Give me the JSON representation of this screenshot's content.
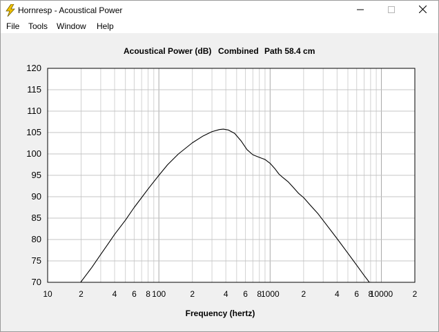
{
  "window": {
    "title": "Hornresp - Acoustical Power",
    "icon": "lightning-bolt-icon"
  },
  "titlebar_buttons": [
    "minimize-icon",
    "maximize-icon",
    "close-icon"
  ],
  "menu": {
    "file": "File",
    "tools": "Tools",
    "window": "Window",
    "help": "Help"
  },
  "chart": {
    "title_parts": [
      "Acoustical Power (dB)",
      "Combined",
      "Path 58.4 cm"
    ],
    "xlabel": "Frequency (hertz)"
  },
  "chart_data": {
    "type": "line",
    "title": "Acoustical Power (dB)   Combined   Path 58.4 cm",
    "xlabel": "Frequency (hertz)",
    "ylabel": "",
    "x_scale": "log",
    "xlim": [
      10,
      20000
    ],
    "ylim": [
      70,
      120
    ],
    "grid": true,
    "y_ticks": [
      70,
      75,
      80,
      85,
      90,
      95,
      100,
      105,
      110,
      115,
      120
    ],
    "x_tick_labels": [
      {
        "value": 10,
        "label": "10"
      },
      {
        "value": 20,
        "label": "2"
      },
      {
        "value": 40,
        "label": "4"
      },
      {
        "value": 60,
        "label": "6"
      },
      {
        "value": 80,
        "label": "8"
      },
      {
        "value": 100,
        "label": "100"
      },
      {
        "value": 200,
        "label": "2"
      },
      {
        "value": 400,
        "label": "4"
      },
      {
        "value": 600,
        "label": "6"
      },
      {
        "value": 800,
        "label": "8"
      },
      {
        "value": 1000,
        "label": "1000"
      },
      {
        "value": 2000,
        "label": "2"
      },
      {
        "value": 4000,
        "label": "4"
      },
      {
        "value": 6000,
        "label": "6"
      },
      {
        "value": 8000,
        "label": "8"
      },
      {
        "value": 10000,
        "label": "10000"
      },
      {
        "value": 20000,
        "label": "2"
      }
    ],
    "series": [
      {
        "color": "#000000",
        "points": [
          [
            19.8,
            70.0
          ],
          [
            25,
            73.5
          ],
          [
            30,
            76.5
          ],
          [
            35,
            79.0
          ],
          [
            40,
            81.2
          ],
          [
            50,
            84.5
          ],
          [
            60,
            87.5
          ],
          [
            70,
            89.8
          ],
          [
            80,
            91.8
          ],
          [
            90,
            93.5
          ],
          [
            100,
            95.0
          ],
          [
            120,
            97.5
          ],
          [
            150,
            100.0
          ],
          [
            200,
            102.6
          ],
          [
            250,
            104.2
          ],
          [
            300,
            105.2
          ],
          [
            350,
            105.7
          ],
          [
            380,
            105.8
          ],
          [
            420,
            105.6
          ],
          [
            480,
            104.8
          ],
          [
            550,
            103.0
          ],
          [
            620,
            101.0
          ],
          [
            700,
            99.8
          ],
          [
            800,
            99.2
          ],
          [
            900,
            98.7
          ],
          [
            1000,
            97.8
          ],
          [
            1100,
            96.6
          ],
          [
            1200,
            95.3
          ],
          [
            1300,
            94.5
          ],
          [
            1450,
            93.5
          ],
          [
            1600,
            92.3
          ],
          [
            1800,
            90.8
          ],
          [
            2000,
            89.8
          ],
          [
            2300,
            88.0
          ],
          [
            2700,
            86.0
          ],
          [
            3200,
            83.5
          ],
          [
            4000,
            80.2
          ],
          [
            5000,
            76.8
          ],
          [
            6000,
            74.0
          ],
          [
            7000,
            71.6
          ],
          [
            7800,
            70.0
          ]
        ]
      }
    ]
  }
}
